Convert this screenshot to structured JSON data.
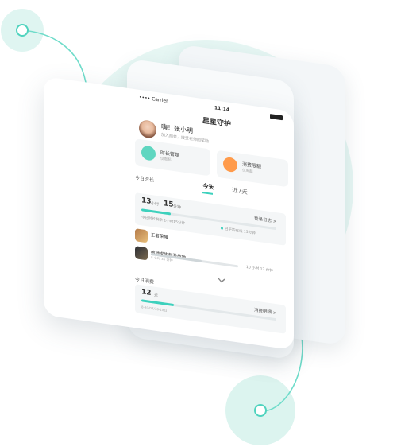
{
  "phone": {
    "status": {
      "carrier": "•••• Carrier",
      "time": "11:14"
    },
    "title": "星星守护",
    "profile": {
      "greeting": "嗨！张小明",
      "subtitle": "加入前会，接受老师的奖励"
    },
    "cards": [
      {
        "label": "时长管理",
        "sub": "仅周起",
        "icon": "clock-icon"
      },
      {
        "label": "消费限额",
        "sub": "仅周起",
        "icon": "coin-icon"
      }
    ],
    "cards_chevron": ">",
    "tabs": {
      "section": "今日时长",
      "items": [
        "今天",
        "近7天"
      ],
      "active": 0
    },
    "usage": {
      "hours": "13",
      "hours_unit": "小时",
      "minutes": "15",
      "minutes_unit": "分钟",
      "log_link": "登录日志 >",
      "progress": 0.22,
      "remaining": "今日时长剩余 1小时15分钟",
      "average": "日平均在线 15分钟"
    },
    "apps": [
      {
        "name": "王者荣耀",
        "progress": 0,
        "icon": "game-icon-honor"
      },
      {
        "name": "绝地求生刺激战场",
        "meta": "8 小时 35 分钟",
        "progress": 0.58,
        "duration": "10 小时 12 分钟",
        "icon": "game-icon-pubg"
      }
    ],
    "expand_icon": "chevron-down-icon",
    "spend": {
      "label": "今日消费",
      "amount": "12",
      "unit": "元",
      "link": "消费明细 >",
      "progress": 0.24,
      "date": "8-20/07/30-18日"
    },
    "colors": {
      "accent": "#3dd1bd",
      "orange": "#ff9b4b"
    }
  }
}
